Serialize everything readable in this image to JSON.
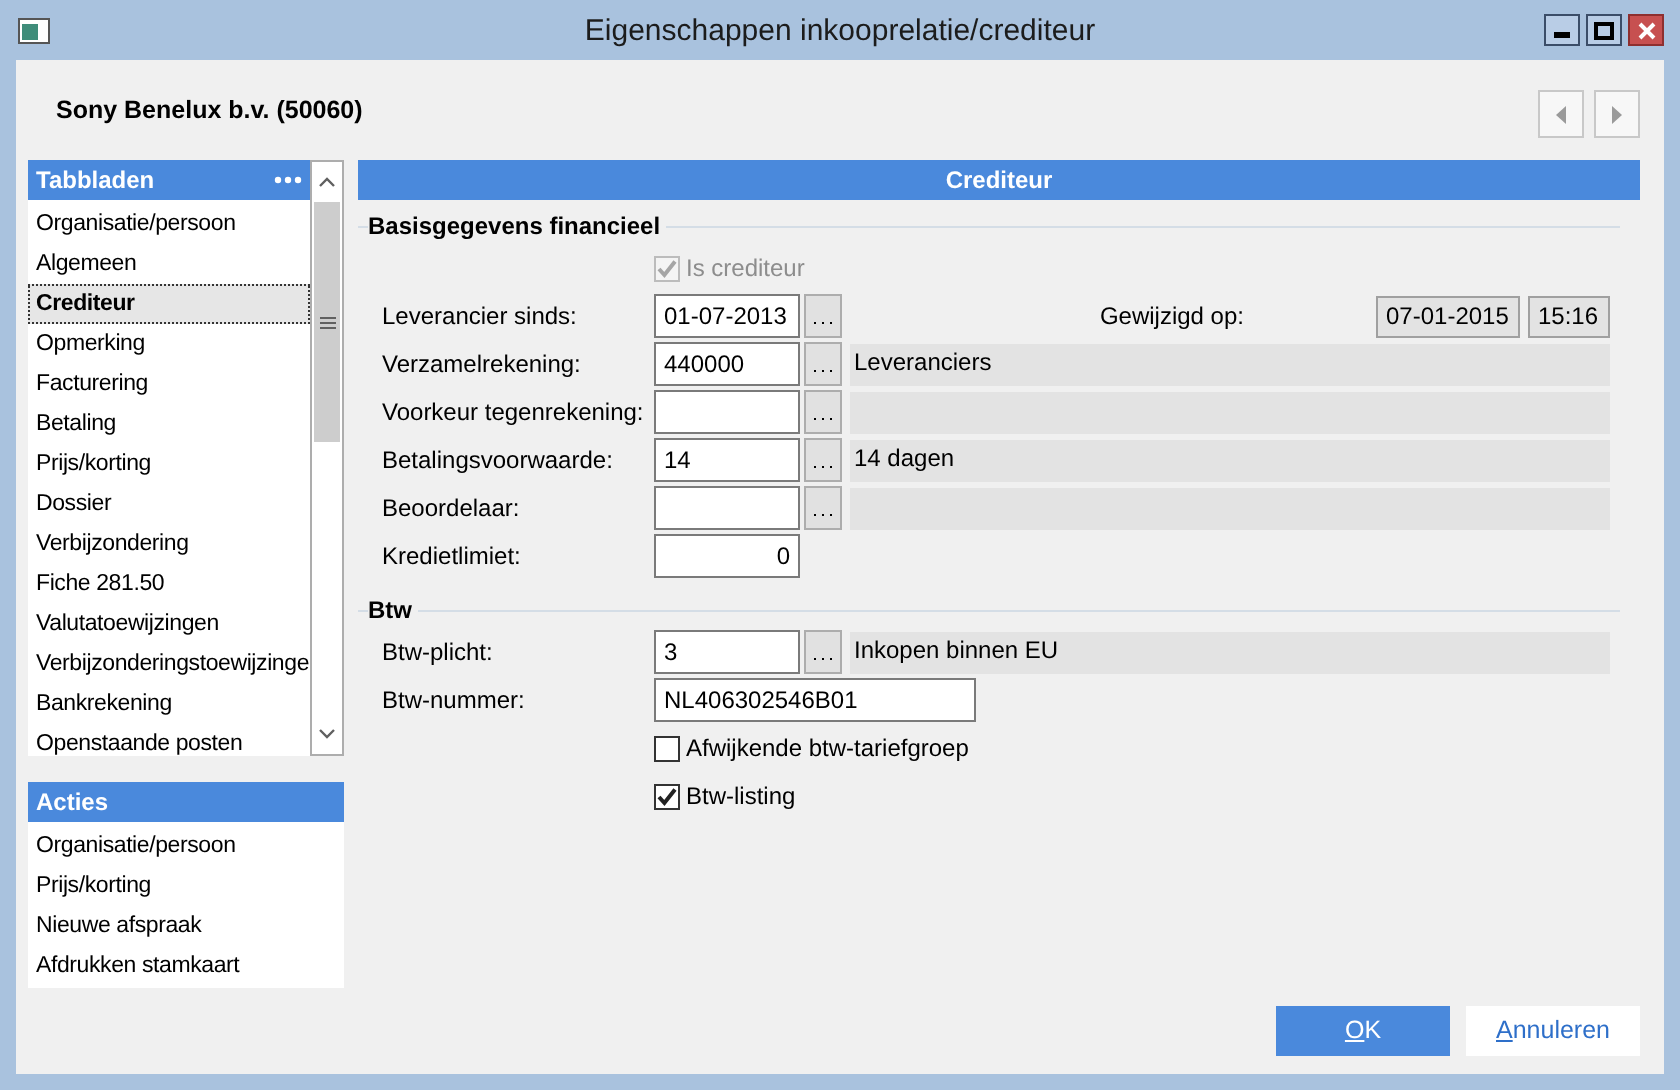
{
  "window": {
    "title": "Eigenschappen inkooprelatie/crediteur"
  },
  "relation": {
    "name": "Sony Benelux b.v. (50060)"
  },
  "tabs": {
    "title": "Tabbladen",
    "items": [
      {
        "label": "Organisatie/persoon",
        "selected": false
      },
      {
        "label": "Algemeen",
        "selected": false
      },
      {
        "label": "Crediteur",
        "selected": true
      },
      {
        "label": "Opmerking",
        "selected": false
      },
      {
        "label": "Facturering",
        "selected": false
      },
      {
        "label": "Betaling",
        "selected": false
      },
      {
        "label": "Prijs/korting",
        "selected": false
      },
      {
        "label": "Dossier",
        "selected": false
      },
      {
        "label": "Verbijzondering",
        "selected": false
      },
      {
        "label": "Fiche 281.50",
        "selected": false
      },
      {
        "label": "Valutatoewijzingen",
        "selected": false
      },
      {
        "label": "Verbijzonderingstoewijzinge",
        "selected": false
      },
      {
        "label": "Bankrekening",
        "selected": false
      },
      {
        "label": "Openstaande posten",
        "selected": false
      }
    ]
  },
  "actions": {
    "title": "Acties",
    "items": [
      {
        "label": "Organisatie/persoon"
      },
      {
        "label": "Prijs/korting"
      },
      {
        "label": "Nieuwe afspraak"
      },
      {
        "label": "Afdrukken stamkaart"
      }
    ]
  },
  "panel": {
    "title": "Crediteur",
    "groups": [
      {
        "title": "Basisgegevens financieel",
        "rows": [
          {
            "kind": "checkbox",
            "label": "Is crediteur",
            "checked": true,
            "disabled": true
          },
          {
            "kind": "lookup",
            "label": "Leverancier sinds:",
            "value": "01-07-2013",
            "modified": {
              "label": "Gewijzigd op:",
              "date": "07-01-2015",
              "time": "15:16"
            }
          },
          {
            "kind": "lookup",
            "label": "Verzamelrekening:",
            "value": "440000",
            "description": "Leveranciers"
          },
          {
            "kind": "lookup",
            "label": "Voorkeur tegenrekening:"
          },
          {
            "kind": "lookup",
            "label": "Betalingsvoorwaarde:",
            "value": "14",
            "description": "14 dagen"
          },
          {
            "kind": "lookup",
            "label": "Beoordelaar:"
          },
          {
            "kind": "amount",
            "label": "Kredietlimiet:",
            "value": "0"
          }
        ]
      },
      {
        "title": "Btw",
        "rows": [
          {
            "kind": "lookup",
            "label": "Btw-plicht:",
            "value": "3",
            "description": "Inkopen binnen EU"
          },
          {
            "kind": "text",
            "label": "Btw-nummer:",
            "value": "NL406302546B01"
          },
          {
            "kind": "checkbox",
            "label": "Afwijkende btw-tariefgroep",
            "checked": false,
            "disabled": false
          },
          {
            "kind": "checkbox",
            "label": "Btw-listing",
            "checked": true,
            "disabled": false
          }
        ]
      }
    ]
  },
  "buttons": [
    {
      "label": "OK",
      "primary": true
    },
    {
      "label": "Annuleren",
      "primary": false
    }
  ]
}
